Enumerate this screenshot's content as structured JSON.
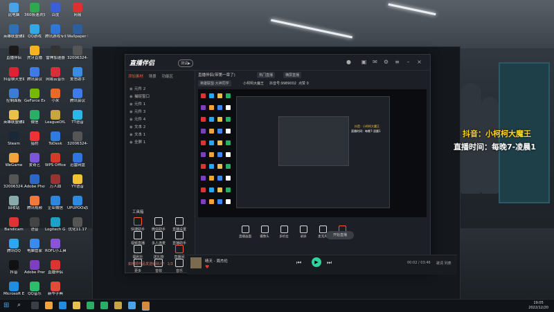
{
  "desktop_icons": [
    {
      "label": "此电脑",
      "c": "#4aa3e8"
    },
    {
      "label": "英雄联盟辅助",
      "c": "#2e6fb7"
    },
    {
      "label": "直播伴侣",
      "c": "#1b1b1b"
    },
    {
      "label": "抖音聊天室编辑",
      "c": "#d23"
    },
    {
      "label": "控制面板",
      "c": "#3d7bd6"
    },
    {
      "label": "英雄联盟辅助 bgm",
      "c": "#e8c14a"
    },
    {
      "label": "Steam",
      "c": "#1b2838"
    },
    {
      "label": "WeGame",
      "c": "#f2a43a"
    },
    {
      "label": "32006324...",
      "c": "#555"
    },
    {
      "label": "回收站",
      "c": "#8aa"
    },
    {
      "label": "Bandicam",
      "c": "#d33"
    },
    {
      "label": "腾讯QQ",
      "c": "#2aa7f0"
    },
    {
      "label": "抖音",
      "c": "#111"
    },
    {
      "label": "Microsoft Edge",
      "c": "#1f8de0"
    },
    {
      "label": "360极速浏览器",
      "c": "#2fa84f"
    },
    {
      "label": "QQ游戏",
      "c": "#31a8e8"
    },
    {
      "label": "虎牙直播",
      "c": "#f8b21e"
    },
    {
      "label": "腾讯会议",
      "c": "#3f7be6"
    },
    {
      "label": "GeForce Experience",
      "c": "#76b900"
    },
    {
      "label": "微信",
      "c": "#2aae67"
    },
    {
      "label": "猎豹",
      "c": "#e33"
    },
    {
      "label": "爱奇艺",
      "c": "#7c55d8"
    },
    {
      "label": "Adobe Photosh...",
      "c": "#2a68c8"
    },
    {
      "label": "腾讯视频",
      "c": "#f2793a"
    },
    {
      "label": "语音",
      "c": "#444"
    },
    {
      "label": "电脑管家",
      "c": "#3a8af0"
    },
    {
      "label": "Adobe Premie...",
      "c": "#7b3fbf"
    },
    {
      "label": "QQ音乐",
      "c": "#2bbd6a"
    },
    {
      "label": "百度",
      "c": "#3a5fd8"
    },
    {
      "label": "腾讯游戏专业加速器",
      "c": "#2e76d8"
    },
    {
      "label": "雷神加速器",
      "c": "#333"
    },
    {
      "label": "网易云音乐",
      "c": "#d8303a"
    },
    {
      "label": "小米",
      "c": "#e86a2a"
    },
    {
      "label": "LeagueOfL...",
      "c": "#c8a443"
    },
    {
      "label": "ToDesk",
      "c": "#2f7ce0"
    },
    {
      "label": "WPS Office",
      "c": "#d23a2a"
    },
    {
      "label": "万人血",
      "c": "#933"
    },
    {
      "label": "企业微信",
      "c": "#2e86e0"
    },
    {
      "label": "Logitech G HUB",
      "c": "#1aa3c8"
    },
    {
      "label": "ROFL小工具",
      "c": "#8a54d8"
    },
    {
      "label": "直播伴侣",
      "c": "#d33"
    },
    {
      "label": "新华字典",
      "c": "#e04b3a"
    },
    {
      "label": "网易",
      "c": "#dd3030"
    },
    {
      "label": "Wallpaper Engine",
      "c": "#2b5f9e"
    },
    {
      "label": "32006324-李涛26",
      "c": "#555"
    },
    {
      "label": "爱思助手",
      "c": "#3b8be0"
    },
    {
      "label": "腾讯会议",
      "c": "#3f7be6"
    },
    {
      "label": "TT语音",
      "c": "#2fb6e8"
    },
    {
      "label": "32006324-李涛21",
      "c": "#555"
    },
    {
      "label": "迅雷网盘",
      "c": "#2f74e0"
    },
    {
      "label": "YY语音",
      "c": "#f1c232"
    },
    {
      "label": "UPUPOO动态桌面",
      "c": "#2e8ae0"
    },
    {
      "label": "优化11.17",
      "c": "#555"
    }
  ],
  "app": {
    "logo": "直播伴侣",
    "badge": "测试▶",
    "left_tabs": [
      "添加素材",
      "场景",
      "功能区"
    ],
    "scenes": [
      "元件 2",
      "捕捉窗口",
      "元件 1",
      "元件 3",
      "元件 4",
      "文本 2",
      "文本 1",
      "全屏 1"
    ],
    "tools_title": "工具箱",
    "tools": [
      {
        "label": "快捷助手"
      },
      {
        "label": "微信助手"
      },
      {
        "label": "直播设置"
      },
      {
        "label": "视频直播"
      },
      {
        "label": "多人连麦"
      },
      {
        "label": "直播助手"
      },
      {
        "label": "福利社"
      },
      {
        "label": "送礼物"
      },
      {
        "label": "直播间"
      },
      {
        "label": "更多"
      },
      {
        "label": "音效"
      },
      {
        "label": "音乐"
      }
    ],
    "tip": "如何把作品发送给别人？",
    "tip_sub": "1/3",
    "header": {
      "line1": "直播伴侣(带第一章了)",
      "pill1": "热门直播",
      "pill2": "横屏直播",
      "line2": "英雄联盟·大神同学",
      "name": "小柯柯大魔王",
      "id": "抖音号:9989002",
      "likes": "点赞 0",
      "count": "0"
    },
    "preview_overlay": [
      "抖音：小柯柯大魔王",
      "直播时间：每晚7-凌晨1"
    ],
    "bottom_buttons": [
      "直播画面",
      "摄像头",
      "多机位",
      "录屏",
      "麦克风",
      "扬声器"
    ],
    "start_label": "开始直播"
  },
  "player": {
    "title": "晴天",
    "artist": "周杰伦",
    "time": "00:02 / 03:46",
    "label": "歌词 列表"
  },
  "overlay": {
    "line1": "抖音：小柯柯大魔王",
    "line2": "直播时间：每晚7-凌晨1"
  },
  "taskbar": {
    "time": "19:05",
    "date": "2022/12/20"
  }
}
